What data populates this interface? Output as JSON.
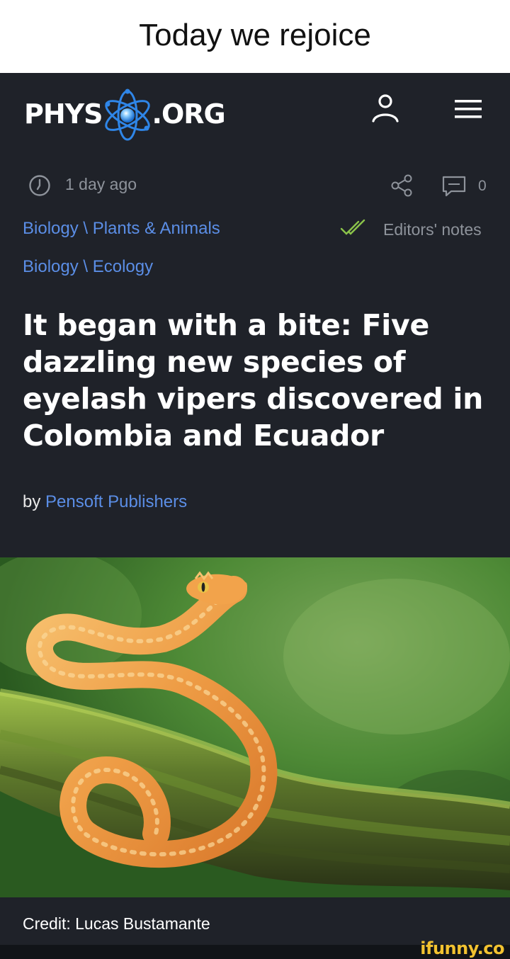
{
  "caption": "Today we rejoice",
  "header": {
    "logo_left": "PHYS",
    "logo_right": ".ORG",
    "icons": [
      "user-icon",
      "menu-icon"
    ]
  },
  "meta": {
    "time": "1 day ago",
    "comment_count": "0",
    "editors_notes": "Editors' notes"
  },
  "breadcrumbs": [
    "Biology \\ Plants & Animals",
    "Biology \\ Ecology"
  ],
  "headline": "It began with a bite: Five dazzling new species of eyelash vipers discovered in Colombia and Ecuador",
  "byline": {
    "prefix": "by",
    "author": "Pensoft Publishers"
  },
  "photo": {
    "credit": "Credit: Lucas Bustamante"
  },
  "watermark": "ifunny.co",
  "colors": {
    "background": "#1f2229",
    "link": "#5b8ee6",
    "muted": "#8e939b",
    "check": "#8bc34a",
    "watermark": "#f2c230"
  }
}
